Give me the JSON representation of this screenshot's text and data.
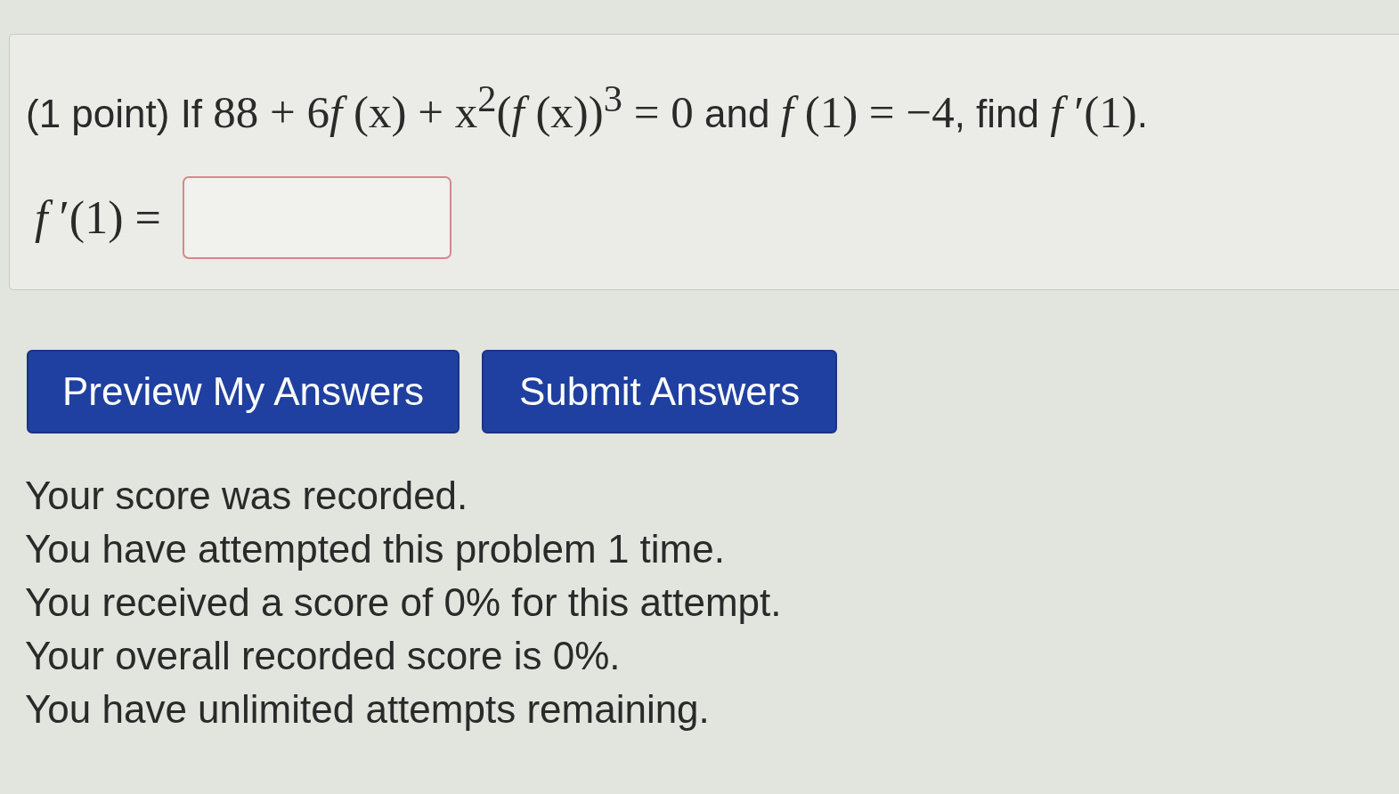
{
  "problem": {
    "statement": [
      {
        "kind": "text",
        "text": "(1 point) If "
      },
      {
        "kind": "math",
        "text": "88 + 6"
      },
      {
        "kind": "math",
        "text": "*f* (x) + x$^{2}$(*f* (x))$^{3}$ = 0"
      },
      {
        "kind": "text",
        "text": " and "
      },
      {
        "kind": "math",
        "text": "*f* (1) = −4"
      },
      {
        "kind": "text",
        "text": ", find "
      },
      {
        "kind": "math",
        "text": "*f* ′(1)"
      },
      {
        "kind": "text",
        "text": "."
      }
    ],
    "answer_label": "*f* ′(1) =",
    "answer_field": {
      "incorrect": true
    }
  },
  "buttons": [
    {
      "label": "Preview My Answers"
    },
    {
      "label": "Submit Answers"
    }
  ],
  "messages": [
    "Your score was recorded.",
    "You have attempted this problem 1 time.",
    "You received a score of 0% for this attempt.",
    "Your overall recorded score is 0%.",
    "You have unlimited attempts remaining."
  ]
}
